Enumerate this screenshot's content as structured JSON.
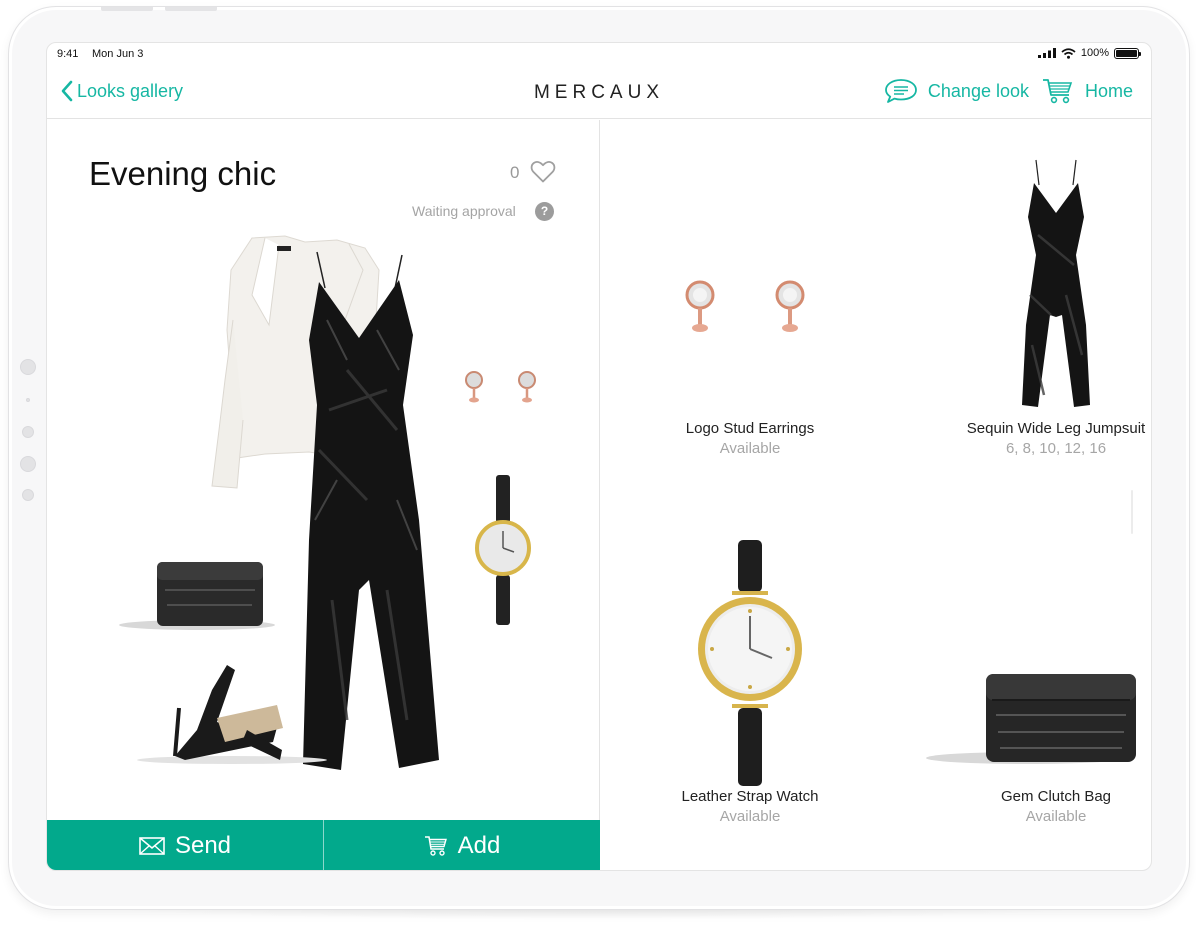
{
  "status_bar": {
    "time": "9:41",
    "date": "Mon Jun 3",
    "battery": "100%"
  },
  "nav": {
    "back_label": "Looks gallery",
    "brand": "MERCAUX",
    "change_look_label": "Change look",
    "home_label": "Home"
  },
  "look": {
    "title": "Evening chic",
    "likes": "0",
    "status": "Waiting approval",
    "help_symbol": "?"
  },
  "actions": {
    "send_label": "Send",
    "add_label": "Add"
  },
  "products": [
    {
      "name": "Logo Stud Earrings",
      "sub": "Available",
      "icon": "stud-earrings"
    },
    {
      "name": "Sequin Wide Leg Jumpsuit",
      "sub": "6, 8, 10, 12, 16",
      "icon": "sequin-jumpsuit"
    },
    {
      "name": "Leather Strap Watch",
      "sub": "Available",
      "icon": "leather-strap-watch"
    },
    {
      "name": "Gem Clutch Bag",
      "sub": "Available",
      "icon": "gem-clutch-bag"
    }
  ],
  "colors": {
    "accent": "#16b7a3",
    "action_bar": "#02a98c",
    "muted_text": "#a6a6a6"
  }
}
